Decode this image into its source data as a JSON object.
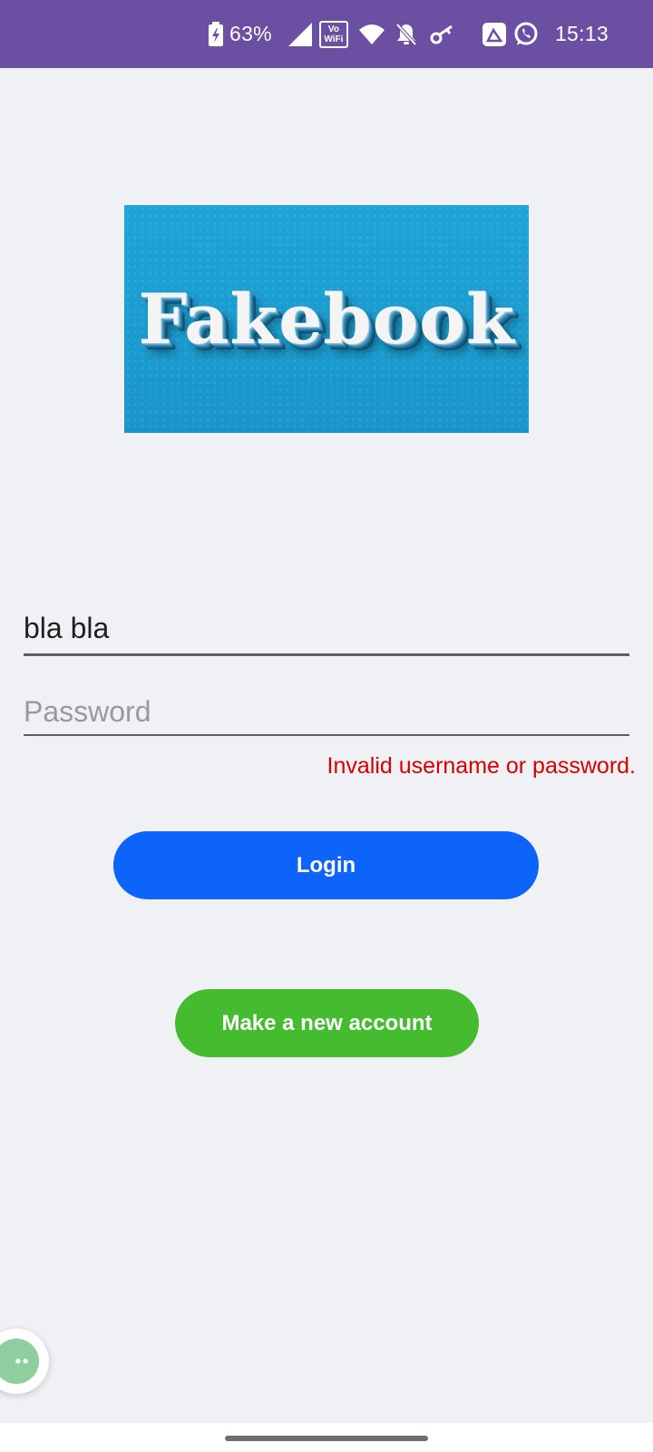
{
  "status_bar": {
    "battery": "63%",
    "vowifi_top": "Vo",
    "vowifi_bottom": "WiFi",
    "time": "15:13",
    "icons": [
      "battery-charging-icon",
      "signal-icon",
      "vowifi-icon",
      "wifi-icon",
      "mute-icon",
      "key-icon",
      "gallery-icon",
      "whatsapp-icon"
    ]
  },
  "logo": {
    "text": "Fakebook"
  },
  "login_form": {
    "username_value": "bla bla",
    "password_placeholder": "Password",
    "error_message": "Invalid username or password.",
    "login_label": "Login",
    "new_account_label": "Make a new account"
  },
  "floating_bubble": {
    "glyph": "••"
  },
  "colors": {
    "status_bar": "#6a4fa3",
    "background": "#f0f1f4",
    "login_button": "#0d64fb",
    "new_account_button": "#45bc2f",
    "error": "#d40000"
  }
}
